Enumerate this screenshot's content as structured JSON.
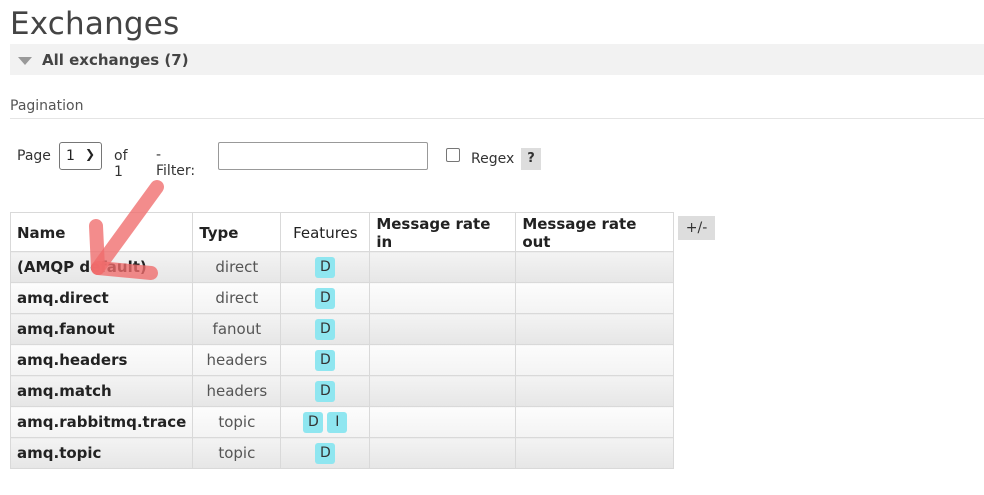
{
  "page": {
    "title": "Exchanges",
    "section_label": "All exchanges (7)",
    "pagination_title": "Pagination"
  },
  "pagination": {
    "page_label": "Page",
    "page_value": "1",
    "page_options": [
      "1"
    ],
    "of_label": "of 1",
    "filter_label": "- Filter:",
    "filter_value": "",
    "regex_label": "Regex",
    "help_label": "?",
    "regex_checked": false
  },
  "table": {
    "columns": [
      "Name",
      "Type",
      "Features",
      "Message rate in",
      "Message rate out"
    ],
    "toggle_label": "+/-",
    "rows": [
      {
        "name": "(AMQP default)",
        "type": "direct",
        "features": [
          "D"
        ],
        "rate_in": "",
        "rate_out": ""
      },
      {
        "name": "amq.direct",
        "type": "direct",
        "features": [
          "D"
        ],
        "rate_in": "",
        "rate_out": ""
      },
      {
        "name": "amq.fanout",
        "type": "fanout",
        "features": [
          "D"
        ],
        "rate_in": "",
        "rate_out": ""
      },
      {
        "name": "amq.headers",
        "type": "headers",
        "features": [
          "D"
        ],
        "rate_in": "",
        "rate_out": ""
      },
      {
        "name": "amq.match",
        "type": "headers",
        "features": [
          "D"
        ],
        "rate_in": "",
        "rate_out": ""
      },
      {
        "name": "amq.rabbitmq.trace",
        "type": "topic",
        "features": [
          "D",
          "I"
        ],
        "rate_in": "",
        "rate_out": ""
      },
      {
        "name": "amq.topic",
        "type": "topic",
        "features": [
          "D"
        ],
        "rate_in": "",
        "rate_out": ""
      }
    ]
  },
  "colors": {
    "feature_badge": "#8fe6f0",
    "annotation_arrow": "#f06b6b"
  },
  "annotation": {
    "icon": "red-arrow-icon",
    "points_to": "amq.direct"
  }
}
